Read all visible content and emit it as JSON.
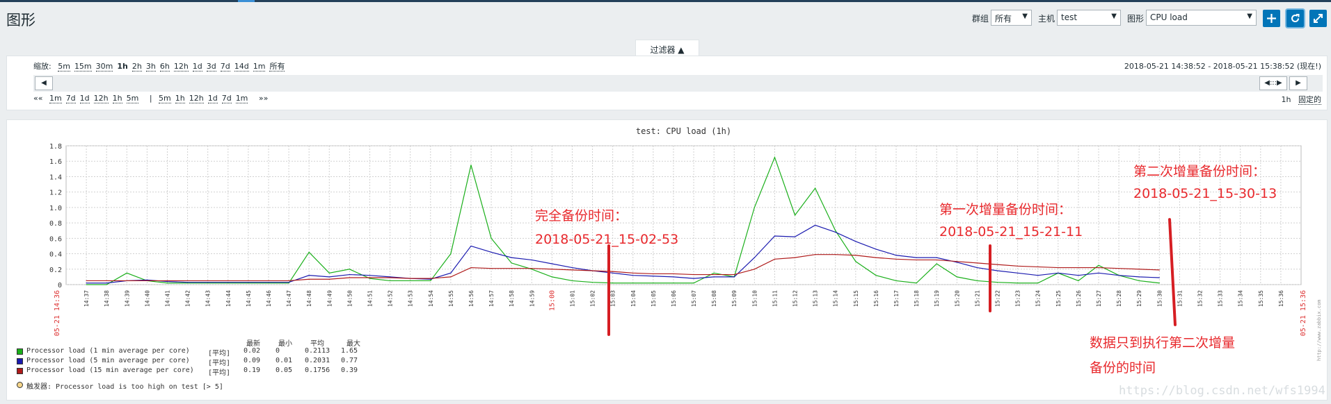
{
  "page": {
    "title": "图形"
  },
  "controls": {
    "group_label": "群组",
    "group_value": "所有",
    "host_label": "主机",
    "host_value": "test",
    "graph_label": "图形",
    "graph_value": "CPU load"
  },
  "filter": {
    "tab_label": "过滤器 ▲",
    "zoom_label": "缩放:",
    "zoom_options": [
      "5m",
      "15m",
      "30m",
      "1h",
      "2h",
      "3h",
      "6h",
      "12h",
      "1d",
      "3d",
      "7d",
      "14d",
      "1m",
      "所有"
    ],
    "zoom_active": "1h",
    "range_text": "2018-05-21 14:38:52 - 2018-05-21 15:38:52 (现在!)",
    "nav_back": "««",
    "nav_back_options": [
      "1m",
      "7d",
      "1d",
      "12h",
      "1h",
      "5m"
    ],
    "nav_separator": "|",
    "nav_fwd_options": [
      "5m",
      "1h",
      "12h",
      "1d",
      "7d",
      "1m"
    ],
    "nav_fwd": "»»",
    "period_value": "1h",
    "fixed_label": "固定的",
    "scroll_left": "◀",
    "scroll_handle": "◀:::▶",
    "scroll_right": "▶"
  },
  "chart_data": {
    "type": "line",
    "title": "test: CPU load (1h)",
    "ylim": [
      0,
      1.8
    ],
    "yticks": [
      "0",
      "0.2",
      "0.4",
      "0.6",
      "0.8",
      "1.0",
      "1.2",
      "1.4",
      "1.6",
      "1.8"
    ],
    "x_labels": [
      "14:37",
      "14:38",
      "14:39",
      "14:40",
      "14:41",
      "14:42",
      "14:43",
      "14:44",
      "14:45",
      "14:46",
      "14:47",
      "14:48",
      "14:49",
      "14:50",
      "14:51",
      "14:52",
      "14:53",
      "14:54",
      "14:55",
      "14:56",
      "14:57",
      "14:58",
      "14:59",
      "15:00",
      "15:01",
      "15:02",
      "15:03",
      "15:04",
      "15:05",
      "15:06",
      "15:07",
      "15:08",
      "15:09",
      "15:10",
      "15:11",
      "15:12",
      "15:13",
      "15:14",
      "15:15",
      "15:16",
      "15:17",
      "15:18",
      "15:19",
      "15:20",
      "15:21",
      "15:22",
      "15:23",
      "15:24",
      "15:25",
      "15:26",
      "15:27",
      "15:28",
      "15:29",
      "15:30",
      "15:31",
      "15:32",
      "15:33",
      "15:34",
      "15:35",
      "15:36"
    ],
    "x_highlight": [
      "15:00"
    ],
    "x_start_label": "05-21 14:36",
    "x_end_label": "05-21 15:36",
    "x": [
      "14:37",
      "14:38",
      "14:39",
      "14:40",
      "14:41",
      "14:42",
      "14:43",
      "14:44",
      "14:45",
      "14:46",
      "14:47",
      "14:48",
      "14:49",
      "14:50",
      "14:51",
      "14:52",
      "14:53",
      "14:54",
      "14:55",
      "14:56",
      "14:57",
      "14:58",
      "14:59",
      "15:00",
      "15:01",
      "15:02",
      "15:03",
      "15:04",
      "15:05",
      "15:06",
      "15:07",
      "15:08",
      "15:09",
      "15:10",
      "15:11",
      "15:12",
      "15:13",
      "15:14",
      "15:15",
      "15:16",
      "15:17",
      "15:18",
      "15:19",
      "15:20",
      "15:21",
      "15:22",
      "15:23",
      "15:24",
      "15:25",
      "15:26",
      "15:27",
      "15:28",
      "15:29",
      "15:30"
    ],
    "series": [
      {
        "name": "Processor load (1 min average per core)",
        "color": "#1aaf1a",
        "values": [
          0.0,
          0.0,
          0.15,
          0.05,
          0.02,
          0.02,
          0.02,
          0.02,
          0.02,
          0.02,
          0.02,
          0.42,
          0.15,
          0.2,
          0.08,
          0.05,
          0.05,
          0.05,
          0.4,
          1.55,
          0.6,
          0.28,
          0.2,
          0.1,
          0.05,
          0.03,
          0.02,
          0.02,
          0.02,
          0.02,
          0.02,
          0.15,
          0.1,
          1.0,
          1.65,
          0.9,
          1.25,
          0.7,
          0.3,
          0.12,
          0.05,
          0.02,
          0.27,
          0.1,
          0.05,
          0.03,
          0.02,
          0.02,
          0.15,
          0.05,
          0.25,
          0.12,
          0.05,
          0.02
        ]
      },
      {
        "name": "Processor load (5 min average per core)",
        "color": "#1a1aaf",
        "values": [
          0.02,
          0.02,
          0.05,
          0.06,
          0.04,
          0.03,
          0.03,
          0.03,
          0.03,
          0.03,
          0.03,
          0.12,
          0.1,
          0.13,
          0.12,
          0.1,
          0.08,
          0.07,
          0.15,
          0.5,
          0.42,
          0.35,
          0.32,
          0.27,
          0.22,
          0.18,
          0.15,
          0.12,
          0.11,
          0.1,
          0.08,
          0.1,
          0.1,
          0.35,
          0.63,
          0.62,
          0.77,
          0.68,
          0.56,
          0.46,
          0.38,
          0.35,
          0.35,
          0.29,
          0.22,
          0.18,
          0.15,
          0.12,
          0.15,
          0.12,
          0.15,
          0.12,
          0.1,
          0.09
        ]
      },
      {
        "name": "Processor load (15 min average per core)",
        "color": "#af1a1a",
        "values": [
          0.05,
          0.05,
          0.05,
          0.05,
          0.05,
          0.05,
          0.05,
          0.05,
          0.05,
          0.05,
          0.05,
          0.07,
          0.07,
          0.09,
          0.09,
          0.09,
          0.08,
          0.08,
          0.1,
          0.22,
          0.21,
          0.21,
          0.21,
          0.2,
          0.19,
          0.18,
          0.17,
          0.15,
          0.14,
          0.14,
          0.13,
          0.13,
          0.13,
          0.2,
          0.33,
          0.35,
          0.39,
          0.39,
          0.38,
          0.35,
          0.33,
          0.32,
          0.32,
          0.3,
          0.28,
          0.26,
          0.24,
          0.23,
          0.22,
          0.22,
          0.22,
          0.21,
          0.2,
          0.19
        ]
      }
    ],
    "trigger_threshold": 5,
    "legend": {
      "headers": [
        "最新",
        "最小",
        "平均",
        "最大"
      ],
      "avg_tag": "[平均]",
      "rows": [
        {
          "label": "Processor load (1 min average per core)",
          "color": "#1aaf1a",
          "last": "0.02",
          "min": "0",
          "avg": "0.2113",
          "max": "1.65"
        },
        {
          "label": "Processor load (5 min average per core)",
          "color": "#1a1aaf",
          "last": "0.09",
          "min": "0.01",
          "avg": "0.2031",
          "max": "0.77"
        },
        {
          "label": "Processor load (15 min average per core)",
          "color": "#af1a1a",
          "last": "0.19",
          "min": "0.05",
          "avg": "0.1756",
          "max": "0.39"
        }
      ],
      "trigger": "触发器: Processor load is too high on test    [> 5]"
    },
    "side_text": "http://www.zabbix.com"
  },
  "annotations": {
    "full_backup_title": "完全备份时间：",
    "full_backup_time": "2018-05-21_15-02-53",
    "inc1_title": "第一次增量备份时间：",
    "inc1_time": "2018-05-21_15-21-11",
    "inc2_title": "第二次增量备份时间：",
    "inc2_time": "2018-05-21_15-30-13",
    "note_line1": "数据只到执行第二次增量",
    "note_line2": "备份的时间"
  },
  "watermark": "https://blog.csdn.net/wfs1994"
}
